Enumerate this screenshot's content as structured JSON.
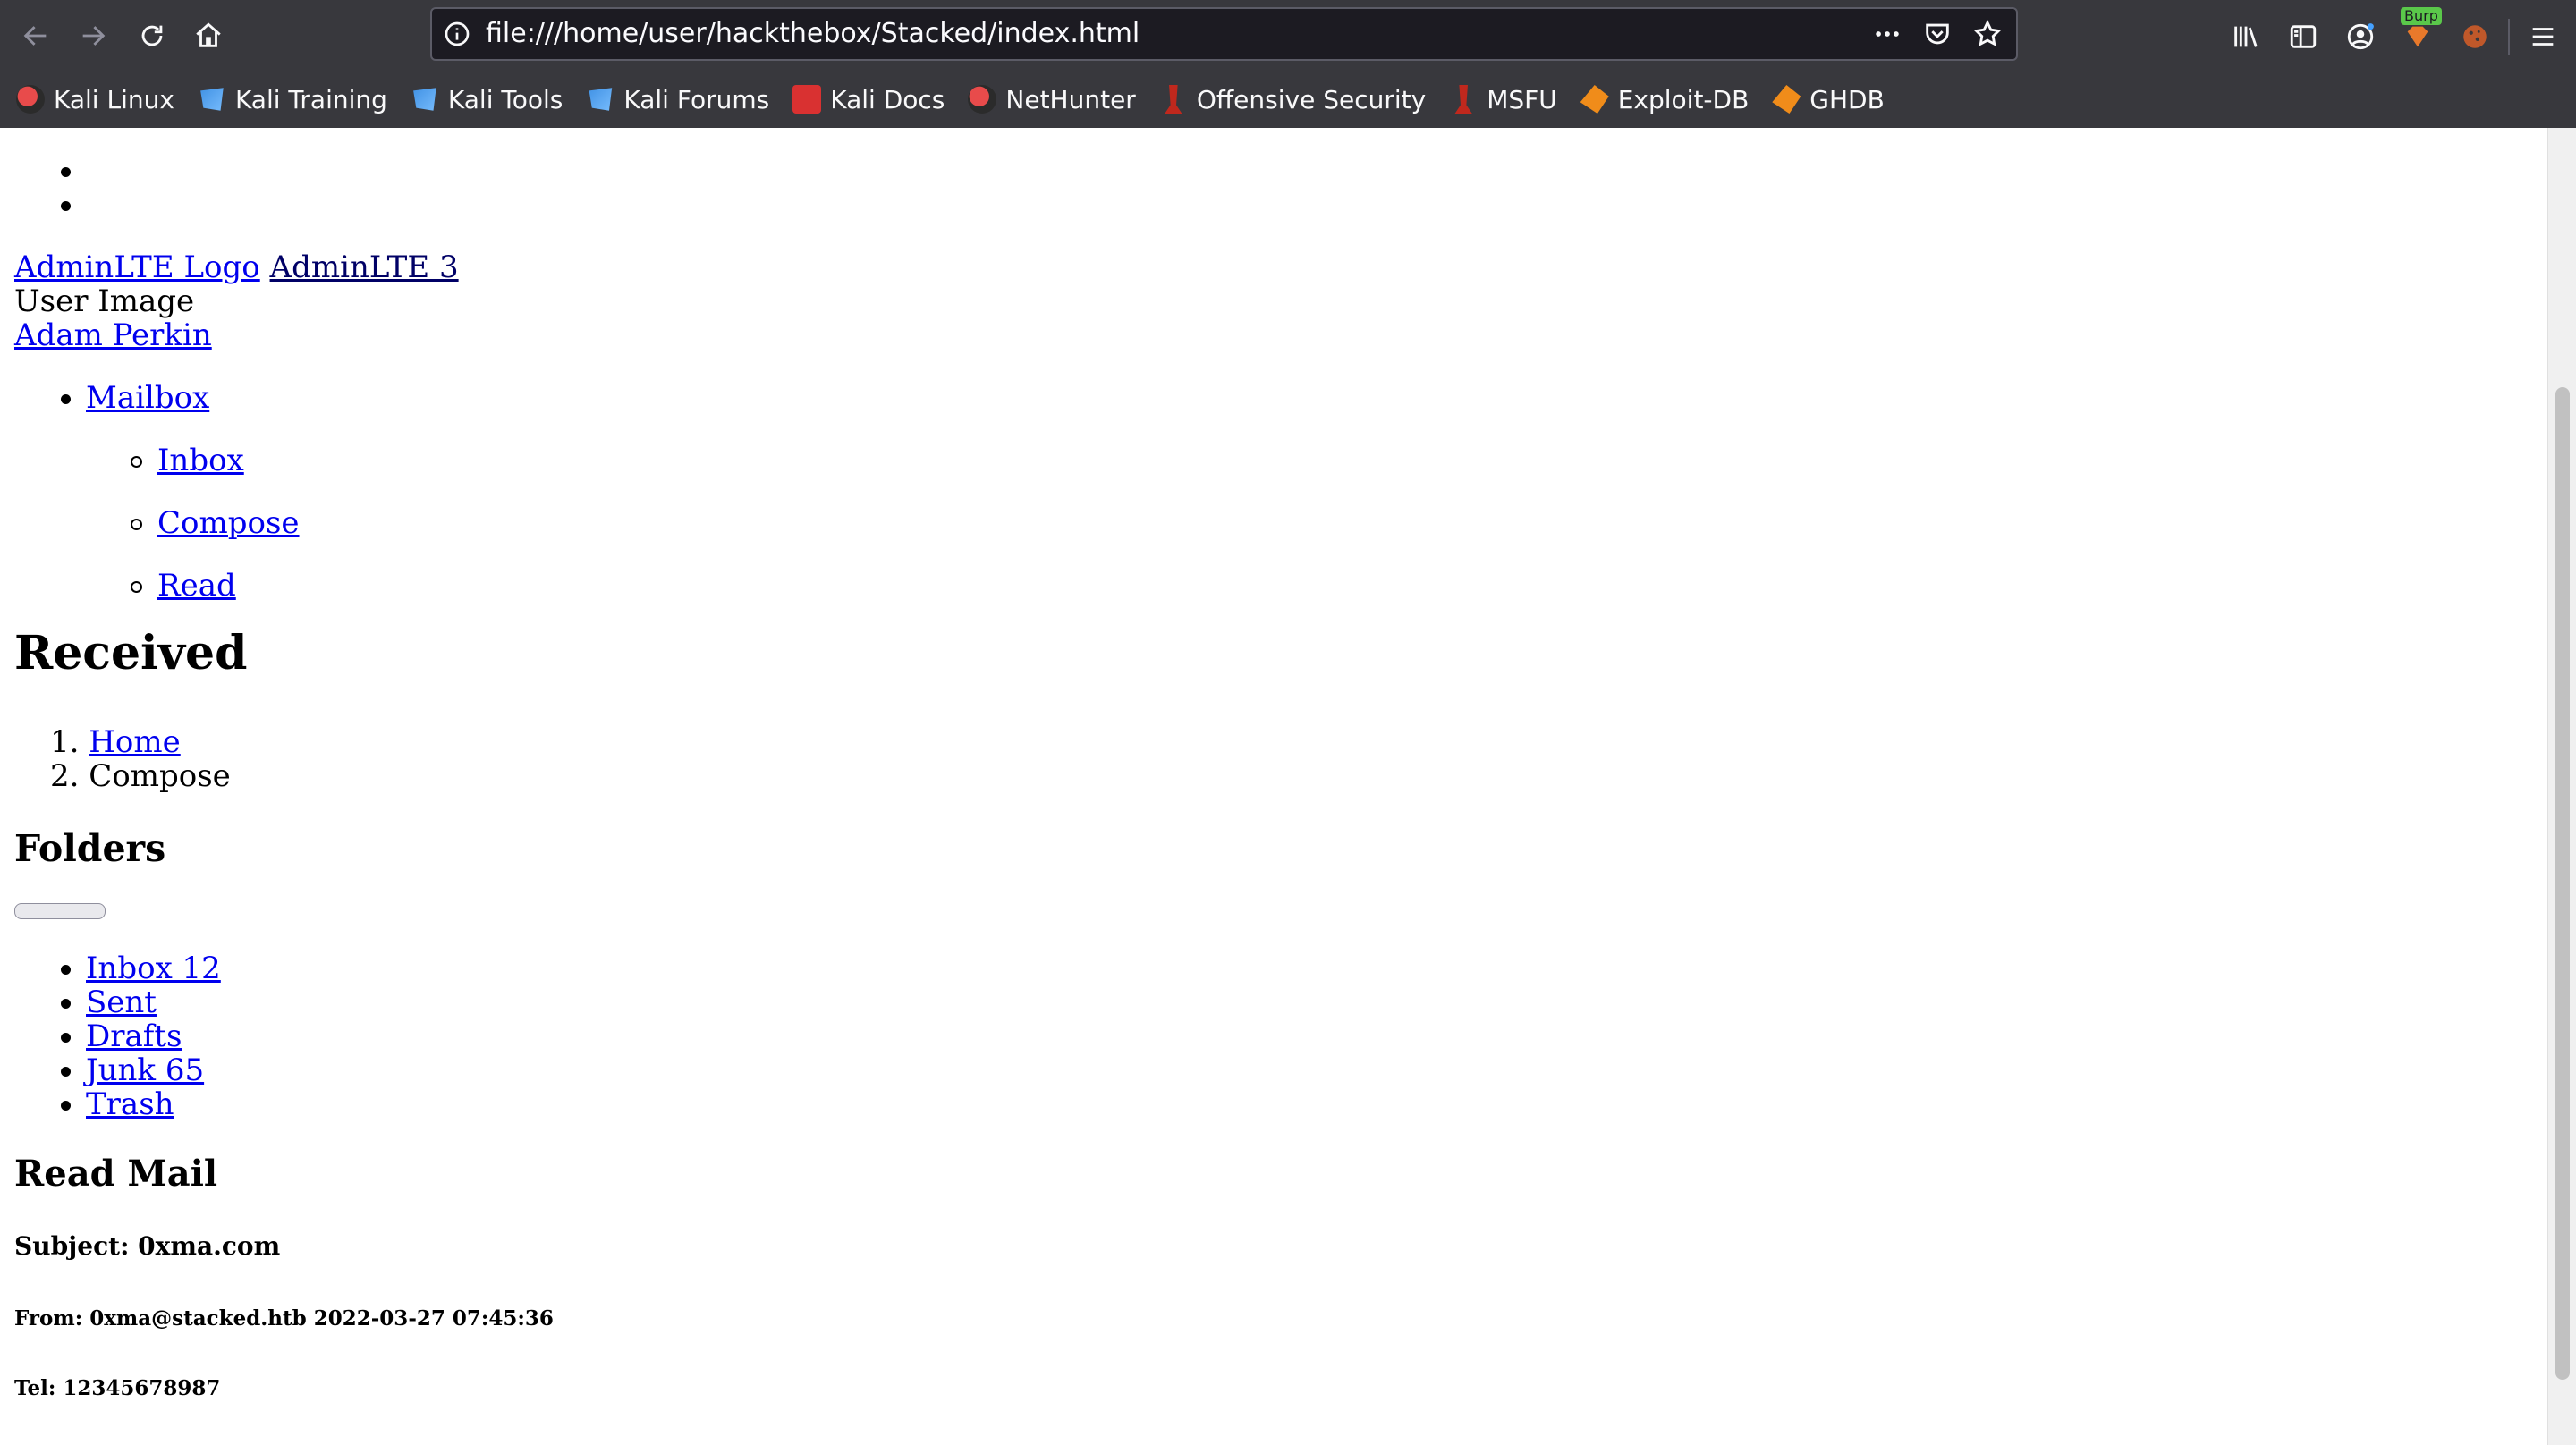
{
  "browser": {
    "url": "file:///home/user/hackthebox/Stacked/index.html",
    "bookmarks": [
      {
        "label": "Kali Linux",
        "icon": "kali-dragon-icon"
      },
      {
        "label": "Kali Training",
        "icon": "kali-tools-icon"
      },
      {
        "label": "Kali Tools",
        "icon": "kali-tools-icon"
      },
      {
        "label": "Kali Forums",
        "icon": "kali-tools-icon"
      },
      {
        "label": "Kali Docs",
        "icon": "kali-docs-icon"
      },
      {
        "label": "NetHunter",
        "icon": "kali-dragon-icon"
      },
      {
        "label": "Offensive Security",
        "icon": "offsec-icon"
      },
      {
        "label": "MSFU",
        "icon": "offsec-icon"
      },
      {
        "label": "Exploit-DB",
        "icon": "exploit-db-icon"
      },
      {
        "label": "GHDB",
        "icon": "exploit-db-icon"
      }
    ],
    "burp_badge": "Burp",
    "colors": {
      "chrome": "#38383d",
      "urlbar": "#1c1b22",
      "link": "#0000ee"
    }
  },
  "page": {
    "brand_logo_alt": "AdminLTE Logo",
    "brand_name": "AdminLTE 3",
    "user_image_alt": "User Image",
    "user_name": "Adam Perkin",
    "nav": {
      "mailbox": "Mailbox",
      "sub": [
        "Inbox",
        "Compose",
        "Read"
      ]
    },
    "title": "Received",
    "breadcrumb": [
      "Home",
      "Compose"
    ],
    "folders_title": "Folders",
    "folders": [
      "Inbox 12",
      "Sent",
      "Drafts",
      "Junk 65",
      "Trash"
    ],
    "read_mail_title": "Read Mail",
    "subject": "Subject: 0xma.com",
    "from": "From: 0xma@stacked.htb 2022-03-27 07:45:36",
    "tel": "Tel: 12345678987"
  }
}
